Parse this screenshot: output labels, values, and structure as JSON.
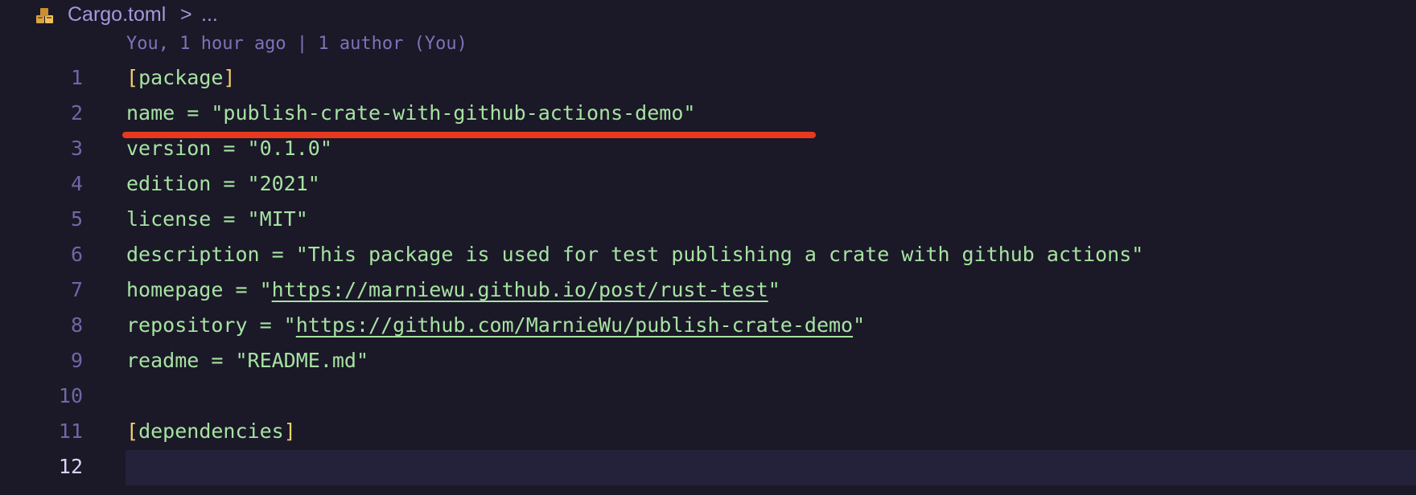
{
  "breadcrumb": {
    "file_name": "Cargo.toml",
    "separator": ">",
    "ellipsis": "...",
    "icon": "cargo-package-icon"
  },
  "blame": {
    "text": "You, 1 hour ago | 1 author (You)"
  },
  "editor": {
    "lines": [
      {
        "number": "1",
        "bracket_open": "[",
        "section": "package",
        "bracket_close": "]"
      },
      {
        "number": "2",
        "key": "name",
        "op": " = ",
        "value": "\"publish-crate-with-github-actions-demo\""
      },
      {
        "number": "3",
        "key": "version",
        "op": " = ",
        "value": "\"0.1.0\""
      },
      {
        "number": "4",
        "key": "edition",
        "op": " = ",
        "value": "\"2021\""
      },
      {
        "number": "5",
        "key": "license",
        "op": " = ",
        "value": "\"MIT\""
      },
      {
        "number": "6",
        "key": "description",
        "op": " = ",
        "value": "\"This package is used for test publishing a crate with github actions\""
      },
      {
        "number": "7",
        "key": "homepage",
        "op": " = ",
        "quote_open": "\"",
        "link": "https://marniewu.github.io/post/rust-test",
        "quote_close": "\""
      },
      {
        "number": "8",
        "key": "repository",
        "op": " = ",
        "quote_open": "\"",
        "link": "https://github.com/MarnieWu/publish-crate-demo",
        "quote_close": "\""
      },
      {
        "number": "9",
        "key": "readme",
        "op": " = ",
        "value": "\"README.md\""
      },
      {
        "number": "10"
      },
      {
        "number": "11",
        "bracket_open": "[",
        "section": "dependencies",
        "bracket_close": "]"
      },
      {
        "number": "12"
      }
    ]
  },
  "colors": {
    "background": "#1b1828",
    "string": "#a6e3a1",
    "bracket": "#f1d06b",
    "line_number": "#6e68a6",
    "annotation": "#e6391e"
  }
}
